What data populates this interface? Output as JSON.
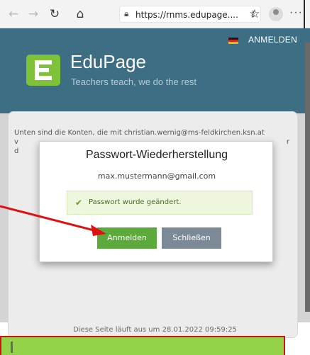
{
  "browser": {
    "url": "https://rnms.edupage....",
    "icons": [
      "back-icon",
      "forward-icon",
      "reload-icon",
      "home-icon",
      "lock-icon",
      "key-icon",
      "favorite-icon",
      "profile-avatar",
      "more-icon"
    ]
  },
  "header": {
    "login_label": "ANMELDEN",
    "brand": "EduPage",
    "tagline": "Teachers teach, we do the rest"
  },
  "panel": {
    "intro_line1": "Unten sind die Konten, die mit christian.wernig@ms-feldkirchen.ksn.at",
    "intro_line2_prefix": "v",
    "intro_line2_suffix": "r",
    "intro_line3": "d",
    "expiry": "Diese Seite läuft aus um 28.01.2022 09:59:25"
  },
  "modal": {
    "title": "Passwort-Wiederherstellung",
    "email": "max.mustermann@gmail.com",
    "success_message": "Passwort wurde geändert.",
    "login_button": "Anmelden",
    "close_button": "Schließen"
  },
  "colors": {
    "header": "#3e6e84",
    "logo": "#7fc23a",
    "login_button": "#5daa3c",
    "close_button": "#7c8996",
    "success_bg": "#eef7dd",
    "callout": "#94d24a",
    "arrow": "#e01010"
  }
}
